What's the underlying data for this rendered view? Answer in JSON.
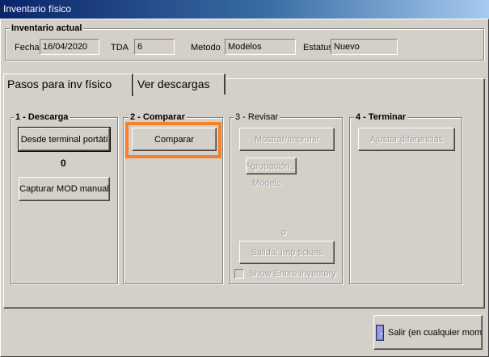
{
  "window": {
    "title": "Inventario físico"
  },
  "current_inventory": {
    "title": "Inventario actual",
    "fecha_label": "Fecha",
    "fecha_value": "16/04/2020",
    "tda_label": "TDA",
    "tda_value": "6",
    "metodo_label": "Metodo",
    "metodo_value": "Modelos",
    "estatus_label": "Estatus",
    "estatus_value": "Nuevo"
  },
  "tabs": [
    {
      "label": "Pasos para inv físico",
      "active": true
    },
    {
      "label": "Ver descargas",
      "active": false
    }
  ],
  "steps": {
    "descarga": {
      "title": "1 - Descarga",
      "terminal_button": "Desde terminal portáti",
      "count": "0",
      "manual_button": "Capturar MOD manual"
    },
    "comparar": {
      "title": "2 - Comparar",
      "compare_button": "Comparar"
    },
    "revisar": {
      "title": "3 - Revisar",
      "show_print_button": "Mostrar/Imprimir",
      "grouping_button": "Agrupación...",
      "grouping_value": "Modelo",
      "or_label": "o",
      "tickets_button": "Salida: Imp tickets",
      "show_entire_label": "Show Entire Inventory",
      "show_entire_checked": false
    },
    "terminar": {
      "title": "4 - Terminar",
      "adjust_button": "Ajustar diferencias"
    }
  },
  "footer": {
    "exit_button": "Salir (en cualquier momento)"
  },
  "colors": {
    "highlight": "#f5822b",
    "titlebar": "#0a246a"
  }
}
